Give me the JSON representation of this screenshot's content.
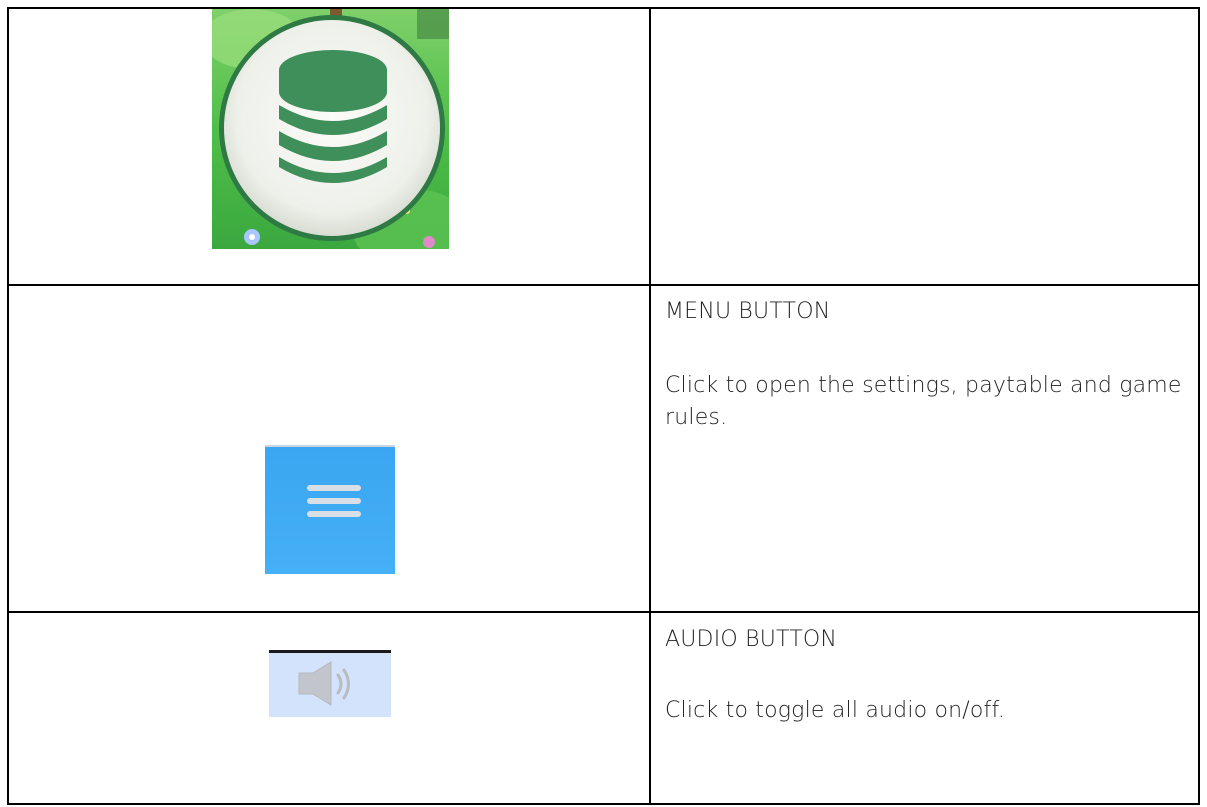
{
  "rows": [
    {
      "icon": "coin-stack-icon",
      "title": "",
      "description": ""
    },
    {
      "icon": "menu-icon",
      "title": "MENU BUTTON",
      "description": "Click to open the settings, paytable and game rules."
    },
    {
      "icon": "speaker-icon",
      "title": "AUDIO BUTTON",
      "description": "Click to toggle all audio on/off."
    }
  ],
  "colors": {
    "coin_green": "#3f8f5a",
    "coin_bg_green": "#5fc24f",
    "menu_blue": "#3faaf3",
    "audio_bg": "#d3e3fb"
  }
}
